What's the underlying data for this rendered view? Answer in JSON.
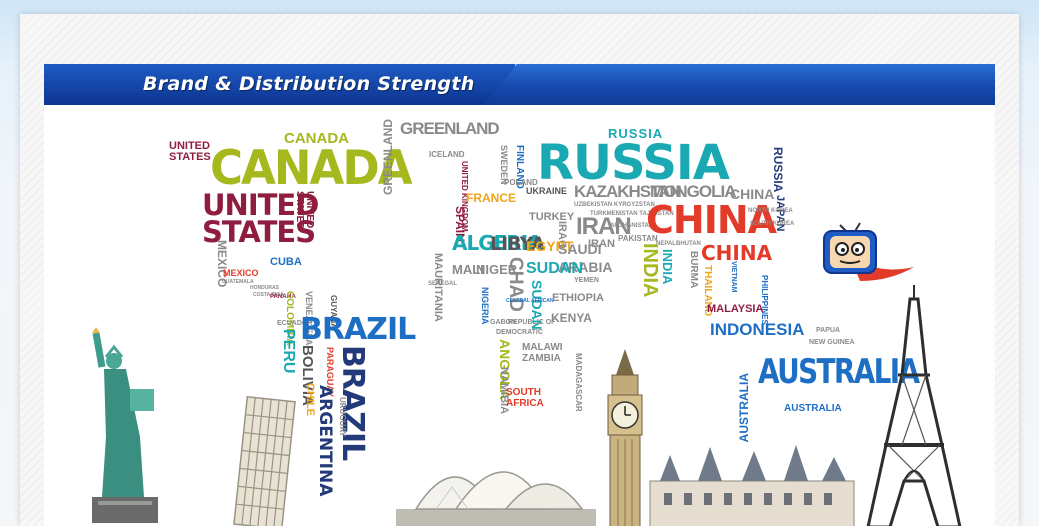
{
  "header": {
    "title": "Brand & Distribution Strength"
  },
  "map_words": {
    "united_states_small": "UNITED STATES",
    "canada_small": "CANADA",
    "canada_big": "CANADA",
    "united_states_big_1": "UNITED",
    "united_states_big_2": "STATES",
    "united_states_vertical": "UNITED STATES",
    "mexico_vertical": "MEXICO",
    "mexico": "MEXICO",
    "cuba": "CUBA",
    "peru": "PERU",
    "brazil": "BRAZIL",
    "brazil_vertical": "BRAZIL",
    "bolivia": "BOLIVIA",
    "paraguay": "PARAGUAY",
    "chile": "CHILE",
    "argentina": "ARGENTINA",
    "uruguay": "URUGUAY",
    "greenland_vertical": "GREENLAND",
    "greenland": "GREENLAND",
    "iceland": "ICELAND",
    "russia_small": "RUSSIA",
    "russia_big": "RUSSIA",
    "russia_vertical": "RUSSIA",
    "japan": "JAPAN",
    "kazakhstan": "KAZAKHSTAN",
    "mongolia": "MONGOLIA",
    "china_small": "CHINA",
    "china_big": "CHINA",
    "china_red": "CHINA",
    "ukraine": "UKRAINE",
    "turkey": "TURKEY",
    "iraq": "IRAQ",
    "iran_big": "IRAN",
    "iran": "IRAN",
    "saudi_arabia_1": "SAUDI",
    "saudi_arabia_2": "ARABIA",
    "france": "FRANCE",
    "spain": "SPAIN",
    "finland": "FINLAND",
    "sweden": "SWEDEN",
    "poland": "POLAND",
    "algeria": "ALGERIA",
    "libya": "LIBYA",
    "egypt": "EGYPT",
    "mali": "MALI",
    "niger": "NIGER",
    "chad": "CHAD",
    "sudan": "SUDAN",
    "ethiopia": "ETHIOPIA",
    "kenya": "KENYA",
    "angola": "ANGOLA",
    "zambia": "ZAMBIA",
    "malawi": "MALAWI",
    "namibia": "NAMIBIA",
    "south_africa_1": "SOUTH",
    "south_africa_2": "AFRICA",
    "madagascar": "MADAGASCAR",
    "yemen": "YEMEN",
    "india": "INDIA",
    "india_2": "INDIA",
    "afghanistan": "AFGHANISTAN",
    "pakistan": "PAKISTAN",
    "nepal": "NEPAL",
    "bhutan": "BHUTAN",
    "burma": "BURMA",
    "thailand": "THAILAND",
    "vietnam": "VIETNAM",
    "philippines": "PHILIPPINES",
    "malaysia": "MALAYSIA",
    "indonesia": "INDONESIA",
    "papua": "PAPUA",
    "new_guinea": "NEW GUINEA",
    "australia": "AUSTRALIA",
    "australia_small": "AUSTRALIA",
    "australia_vertical": "AUSTRALIA",
    "north_korea": "NORTH KOREA",
    "south_korea": "SOUTH KOREA",
    "uzbekistan": "UZBEKISTAN KYRGYZSTAN",
    "turkmenistan": "TURKMENISTAN TAJIKISTAN",
    "mauritania": "MAURITANIA",
    "senegal": "SENEGAL",
    "nigeria": "NIGERIA",
    "gabon": "GABON",
    "republic_of_congo": "REPUBLIC OF",
    "democratic": "DEMOCRATIC",
    "central_african": "CENTRAL AFRICAN",
    "guatemala": "GUATEMALA",
    "honduras": "HONDURAS",
    "costa": "COSTA RICA",
    "panama": "PANAMA",
    "colombia": "COLOMBIA",
    "venezuela": "VENEZUELA",
    "ecuador": "ECUADOR",
    "guyana": "GUYANA"
  },
  "colors": {
    "banner_blue": "#1a4fb5",
    "teal": "#1aa9b3",
    "olive": "#a5b81d",
    "maroon": "#8e1d3f",
    "navy": "#223a7a",
    "red": "#e33b2a",
    "blue": "#1e6fc4"
  },
  "mascot": {
    "name": "tv-mascot-icon"
  },
  "landmarks": [
    "statue-of-liberty-icon",
    "leaning-tower-of-pisa-icon",
    "sydney-opera-house-icon",
    "big-ben-icon",
    "chateau-icon",
    "eiffel-tower-icon"
  ]
}
